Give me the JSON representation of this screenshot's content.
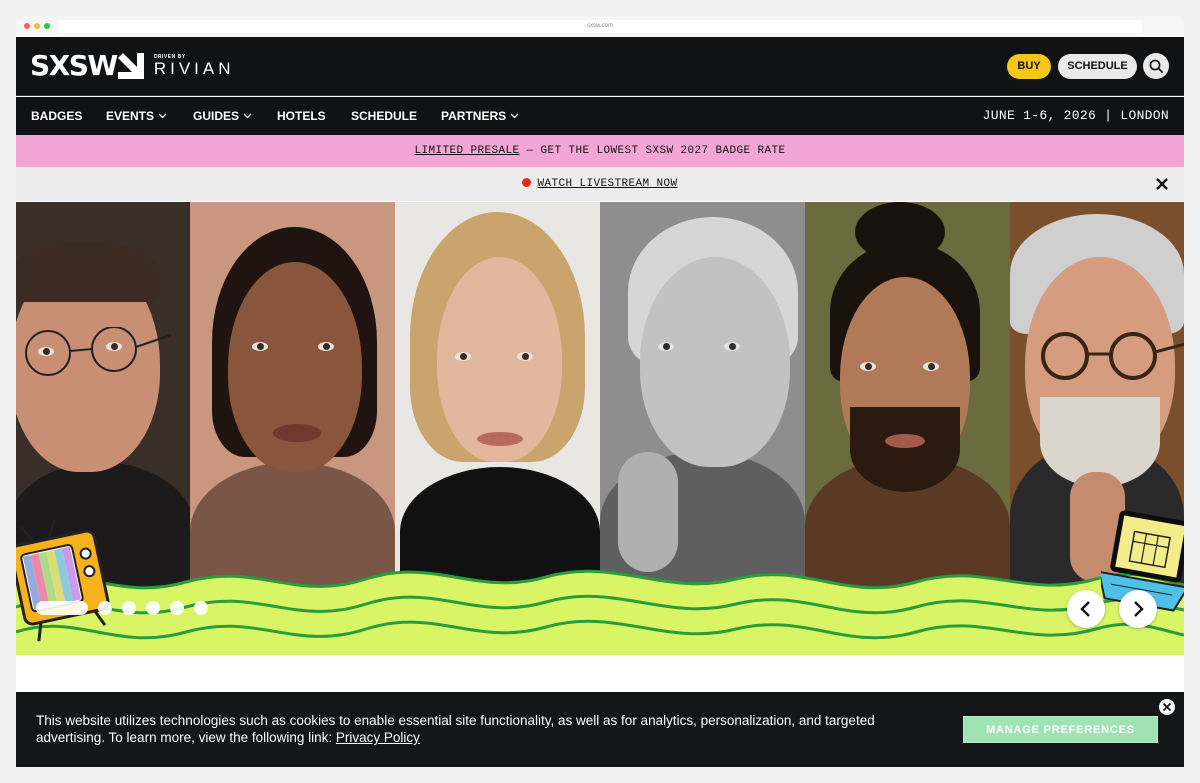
{
  "browser": {
    "url": "sxsw.com"
  },
  "header": {
    "logo_text": "SXSW",
    "logo_driven": "DRIVEN BY",
    "logo_partner": "RIVIAN",
    "buy_label": "BUY",
    "schedule_label": "SCHEDULE",
    "search_icon": "search-icon"
  },
  "nav": {
    "items": [
      {
        "label": "BADGES",
        "dropdown": false
      },
      {
        "label": "EVENTS",
        "dropdown": true
      },
      {
        "label": "GUIDES",
        "dropdown": true
      },
      {
        "label": "HOTELS",
        "dropdown": false
      },
      {
        "label": "SCHEDULE",
        "dropdown": false
      },
      {
        "label": "PARTNERS",
        "dropdown": true
      }
    ],
    "event_info": "JUNE 1-6, 2026 | LONDON"
  },
  "presale": {
    "link": "LIMITED PRESALE",
    "text": " — GET THE LOWEST SXSW 2027 BADGE RATE"
  },
  "livestream": {
    "link": "WATCH LIVESTREAM NOW"
  },
  "carousel": {
    "slide_count": 6,
    "active_index": 0
  },
  "cookie": {
    "text": "This website utilizes technologies such as cookies to enable essential site functionality, as well as for analytics, personalization, and targeted advertising. To learn more, view the following link: ",
    "link": "Privacy Policy",
    "manage_label": "MANAGE PREFERENCES"
  },
  "colors": {
    "header_bg": "#111214",
    "buy": "#f5c518",
    "presale_bg": "#f3a6d6",
    "hero_green": "#d9f566",
    "wave_line": "#2a9d3a",
    "manage_btn": "#9fe3b4",
    "live_dot": "#e32b1a"
  }
}
